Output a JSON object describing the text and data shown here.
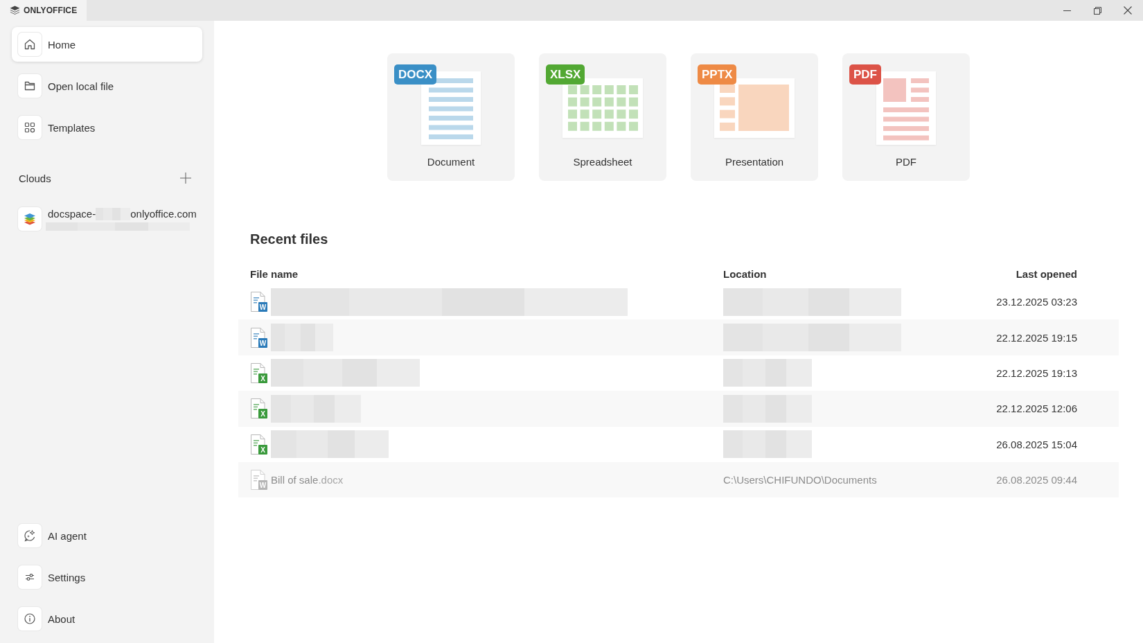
{
  "title_bar": {
    "app_name": "ONLYOFFICE"
  },
  "sidebar": {
    "top_items": [
      {
        "label": "Home",
        "selected": true
      },
      {
        "label": "Open local file",
        "selected": false
      },
      {
        "label": "Templates",
        "selected": false
      }
    ],
    "clouds": {
      "heading": "Clouds",
      "accounts": [
        {
          "label_parts": [
            "docspace-",
            "onlyoffice.com"
          ],
          "redacted": true
        }
      ]
    },
    "bottom_items": [
      {
        "label": "AI agent",
        "selected": false
      },
      {
        "label": "Settings",
        "selected": false
      },
      {
        "label": "About",
        "selected": false
      }
    ]
  },
  "new_file_cards": [
    {
      "kind": "document",
      "badge": "DOCX",
      "label": "Document",
      "color": "#3a8fc6"
    },
    {
      "kind": "spreadsheet",
      "badge": "XLSX",
      "label": "Spreadsheet",
      "color": "#52a833"
    },
    {
      "kind": "presentation",
      "badge": "PPTX",
      "label": "Presentation",
      "color": "#ee8a45"
    },
    {
      "kind": "pdf",
      "badge": "PDF",
      "label": "PDF",
      "color": "#dc5347"
    }
  ],
  "recent_files": {
    "title": "Recent files",
    "columns": [
      "File name",
      "Location",
      "Last opened"
    ],
    "rows": [
      {
        "kind": "docx",
        "icon_letter": "W",
        "redacted": true,
        "last_opened": "23.12.2025 03:23",
        "unavailable": false
      },
      {
        "kind": "docx",
        "icon_letter": "W",
        "redacted": true,
        "last_opened": "22.12.2025 19:15",
        "unavailable": false
      },
      {
        "kind": "xlsx",
        "icon_letter": "X",
        "redacted": true,
        "last_opened": "22.12.2025 19:13",
        "unavailable": false
      },
      {
        "kind": "xlsx",
        "icon_letter": "X",
        "redacted": true,
        "last_opened": "22.12.2025 12:06",
        "unavailable": false
      },
      {
        "kind": "xlsx",
        "icon_letter": "X",
        "redacted": true,
        "last_opened": "26.08.2025 15:04",
        "unavailable": false
      },
      {
        "kind": "docx",
        "icon_letter": "W",
        "redacted": false,
        "name": "Bill of sale",
        "extension": ".docx",
        "location": "C:\\Users\\CHIFUNDO\\Documents",
        "last_opened": "26.08.2025 09:44",
        "unavailable": true
      }
    ]
  }
}
